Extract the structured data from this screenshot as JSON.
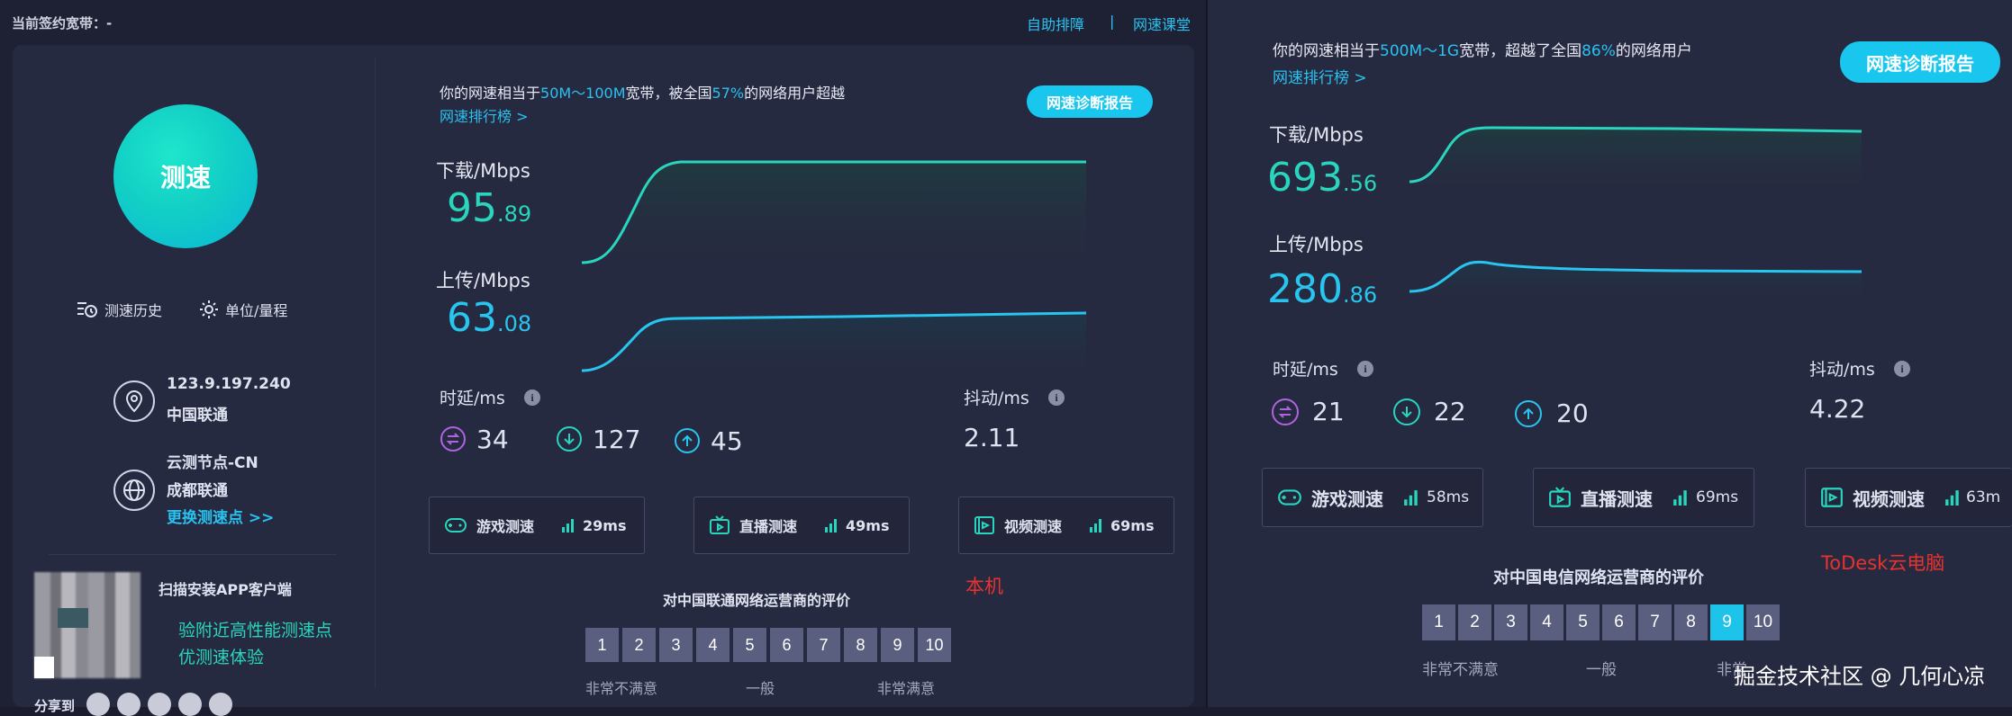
{
  "left": {
    "topbar": {
      "bandwidth_label": "当前签约宽带：-",
      "help_link": "自助排障",
      "separator": "|",
      "class_link": "网速课堂"
    },
    "start_button": "测速",
    "history_label": "测速历史",
    "unit_label": "单位/量程",
    "ip": "123.9.197.240",
    "isp": "中国联通",
    "node_title": "云测节点-CN",
    "node_location": "成都联通",
    "change_node": "更换测速点 >>",
    "app_title": "扫描安装APP客户端",
    "app_line1": "验附近高性能测速点",
    "app_line2": "优测速体验",
    "share_label": "分享到",
    "summary_prefix": "你的网速相当于",
    "summary_range": "50M～100M",
    "summary_mid": "宽带，被全国",
    "summary_pct": "57%",
    "summary_suffix": "的网络用户超越",
    "rank_link": "网速排行榜 >",
    "report_button": "网速诊断报告",
    "download_label": "下载/Mbps",
    "download_int": "95",
    "download_dec": ".89",
    "upload_label": "上传/Mbps",
    "upload_int": "63",
    "upload_dec": ".08",
    "latency_label": "时延/ms",
    "latency_values": [
      "34",
      "127",
      "45"
    ],
    "jitter_label": "抖动/ms",
    "jitter_value": "2.11",
    "tests": [
      {
        "label": "游戏测速",
        "value": "29ms"
      },
      {
        "label": "直播测速",
        "value": "49ms"
      },
      {
        "label": "视频测速",
        "value": "69ms"
      }
    ],
    "machine_tag": "本机",
    "rating_title": "对中国联通网络运营商的评价",
    "rating_numbers": [
      "1",
      "2",
      "3",
      "4",
      "5",
      "6",
      "7",
      "8",
      "9",
      "10"
    ],
    "rating_low": "非常不满意",
    "rating_mid": "一般",
    "rating_high": "非常满意"
  },
  "right": {
    "summary_prefix": "你的网速相当于",
    "summary_range": "500M～1G",
    "summary_mid": "宽带，超越了全国",
    "summary_pct": "86%",
    "summary_suffix": "的网络用户",
    "rank_link": "网速排行榜 >",
    "report_button": "网速诊断报告",
    "download_label": "下载/Mbps",
    "download_int": "693",
    "download_dec": ".56",
    "upload_label": "上传/Mbps",
    "upload_int": "280",
    "upload_dec": ".86",
    "latency_label": "时延/ms",
    "latency_values": [
      "21",
      "22",
      "20"
    ],
    "jitter_label": "抖动/ms",
    "jitter_value": "4.22",
    "tests": [
      {
        "label": "游戏测速",
        "value": "58ms"
      },
      {
        "label": "直播测速",
        "value": "69ms"
      },
      {
        "label": "视频测速",
        "value": "63m"
      }
    ],
    "todesk_tag": "ToDesk云电脑",
    "rating_title": "对中国电信网络运营商的评价",
    "rating_numbers": [
      "1",
      "2",
      "3",
      "4",
      "5",
      "6",
      "7",
      "8",
      "9",
      "10"
    ],
    "rating_selected": 9,
    "rating_low": "非常不满意",
    "rating_mid": "一般",
    "rating_high": "非常",
    "watermark": "掘金技术社区 @ 几何心凉"
  },
  "colors": {
    "teal": "#29d5bd",
    "cyan": "#28c5ee",
    "accent": "#19c6ee",
    "panel": "#262a40",
    "red_tag": "#e8322e"
  }
}
